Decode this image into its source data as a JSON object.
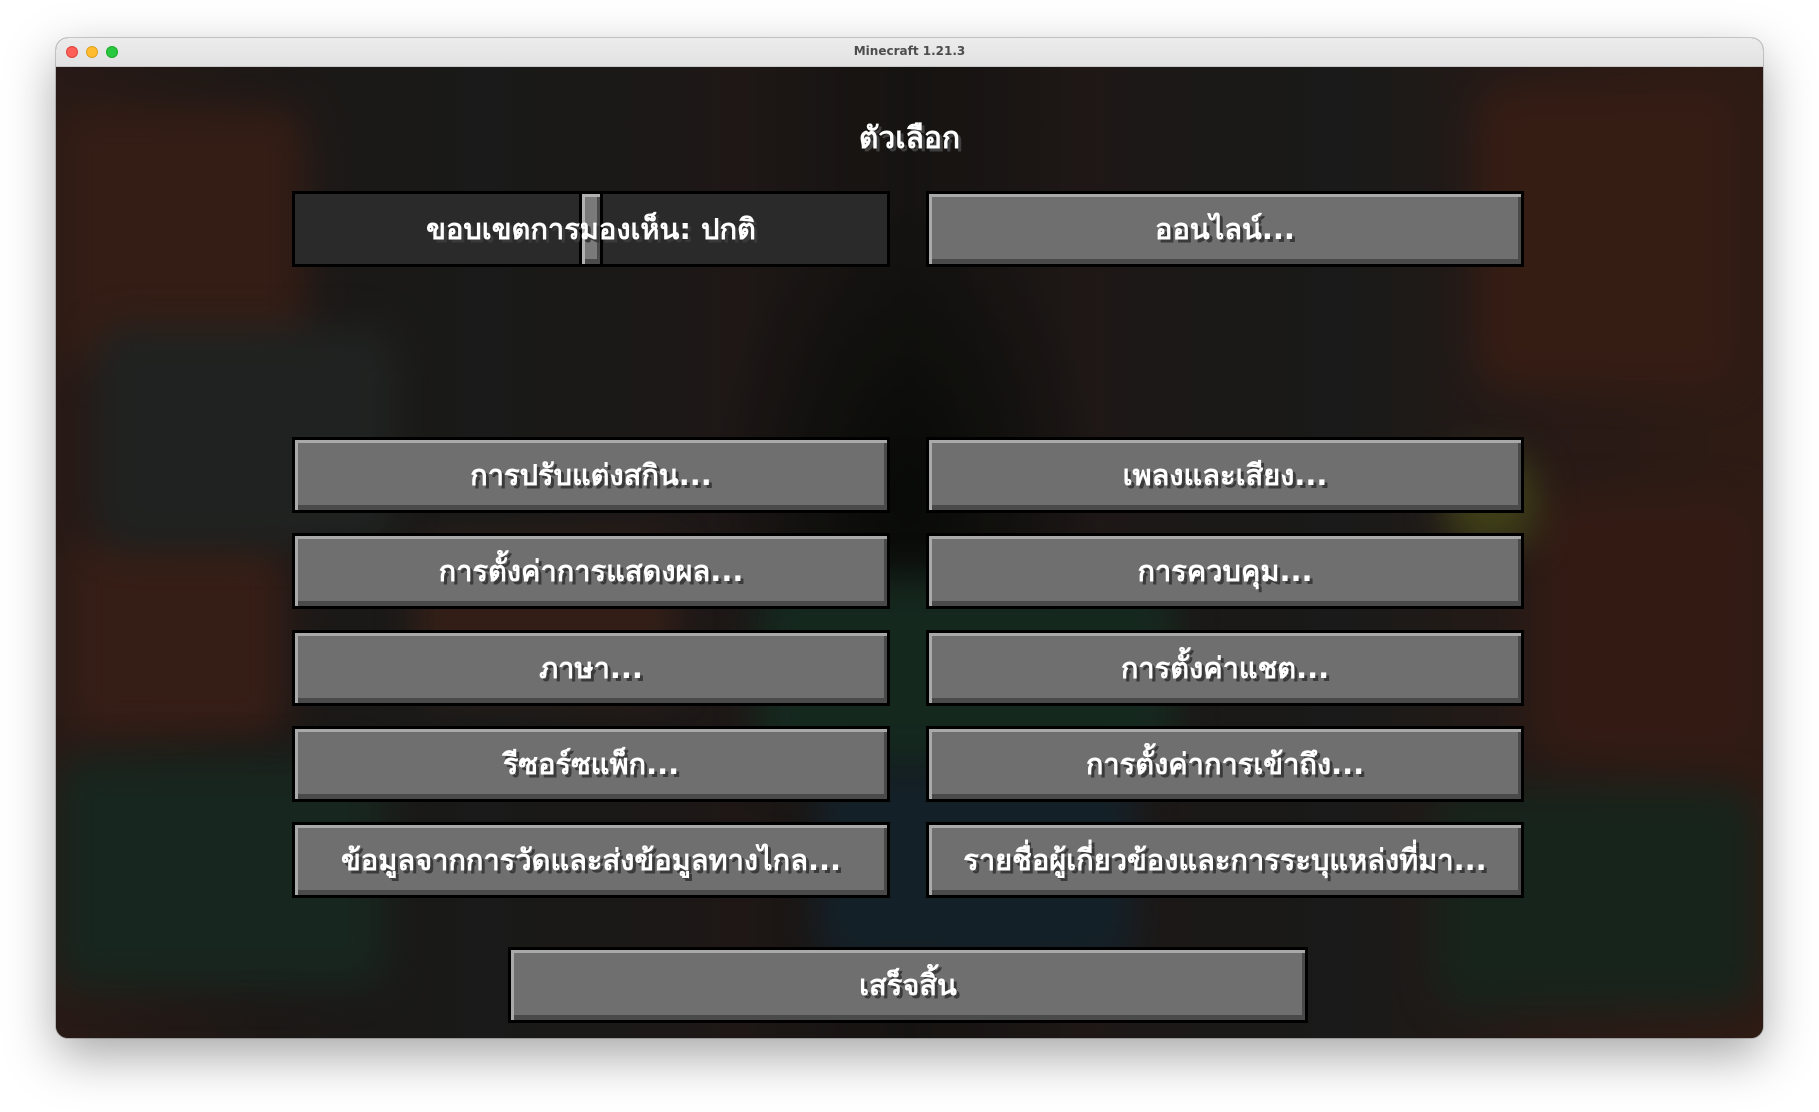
{
  "window": {
    "title": "Minecraft 1.21.3"
  },
  "screen": {
    "title": "ตัวเลือก"
  },
  "fov_slider": {
    "label": "ขอบเขตการมองเห็น: ปกติ",
    "value_fraction": 0.5
  },
  "buttons": {
    "online": "ออนไลน์...",
    "skin": "การปรับแต่งสกิน...",
    "music": "เพลงและเสียง...",
    "video": "การตั้งค่าการแสดงผล...",
    "controls": "การควบคุม...",
    "language": "ภาษา...",
    "chat": "การตั้งค่าแชต...",
    "resource_packs": "รีซอร์ซแพ็ก...",
    "accessibility": "การตั้งค่าการเข้าถึง...",
    "telemetry": "ข้อมูลจากการวัดและส่งข้อมูลทางไกล...",
    "credits": "รายชื่อผู้เกี่ยวข้องและการระบุแหล่งที่มา...",
    "done": "เสร็จสิ้น"
  },
  "colors": {
    "button_face": "#6f6f6f",
    "slider_track": "#2a2a2a",
    "text": "#ffffff"
  }
}
